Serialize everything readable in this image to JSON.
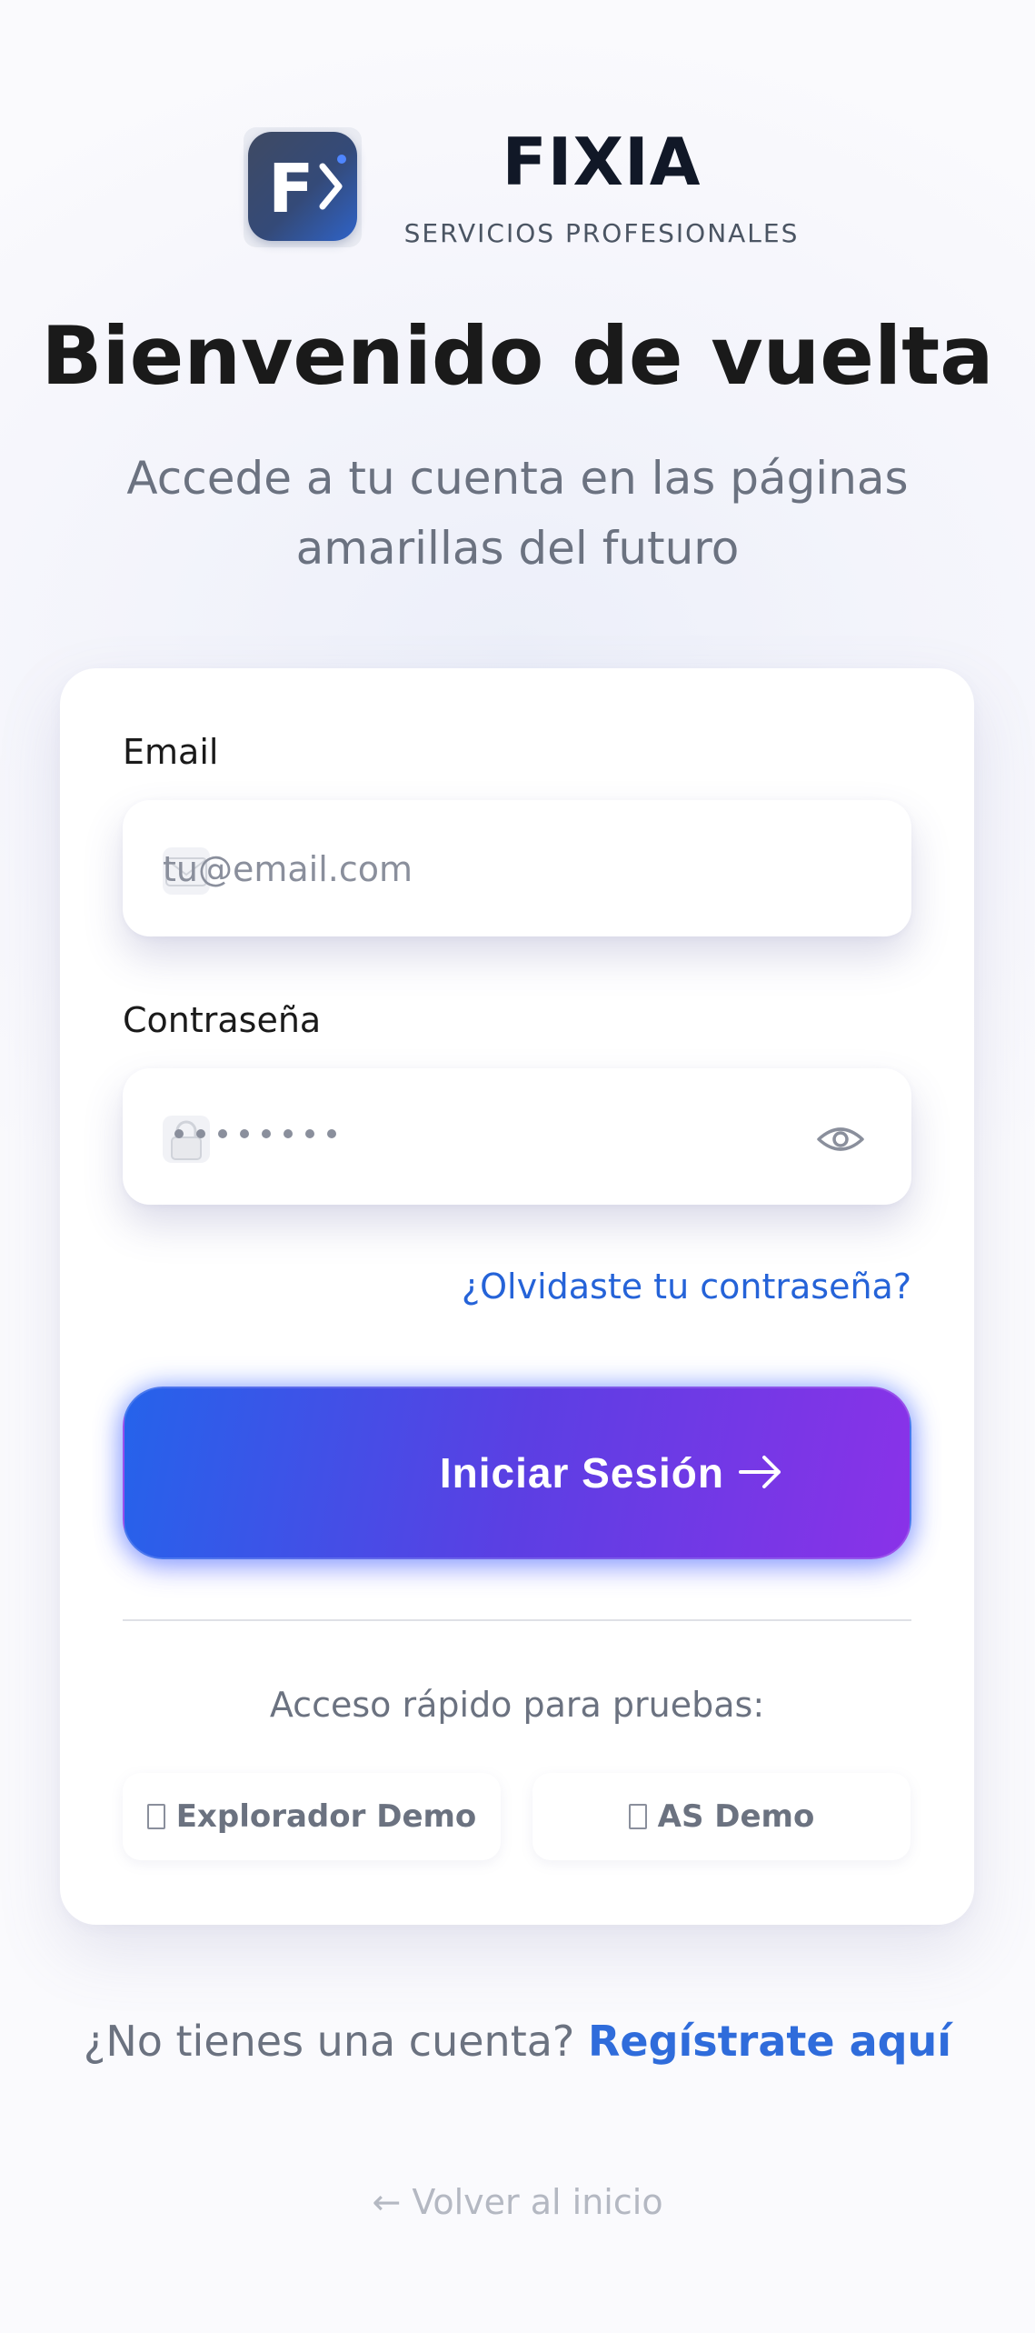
{
  "brand": {
    "name": "FIXIA",
    "tagline": "SERVICIOS PROFESIONALES",
    "logo_letter": "F"
  },
  "welcome": {
    "title": "Bienvenido de vuelta",
    "subtitle": "Accede a tu cuenta en las páginas amarillas del futuro"
  },
  "form": {
    "email": {
      "label": "Email",
      "placeholder": "tu@email.com",
      "value": "",
      "icon": "mail-icon"
    },
    "password": {
      "label": "Contraseña",
      "masked_length": 8,
      "icon": "lock-icon",
      "toggle_icon": "eye-icon"
    },
    "forgot_link": "¿Olvidaste tu contraseña?",
    "submit_label": "Iniciar Sesión",
    "submit_icon": "arrow-right-icon"
  },
  "quick_access": {
    "label": "Acceso rápido para pruebas:",
    "buttons": [
      {
        "label": "Explorador Demo"
      },
      {
        "label": "AS Demo"
      }
    ]
  },
  "footer": {
    "signup_prompt": "¿No tienes una cuenta?",
    "signup_link": "Regístrate aquí",
    "back_link": "← Volver al inicio"
  },
  "colors": {
    "primary_blue": "#2563eb",
    "primary_purple": "#8a32e8",
    "link_blue": "#2563d8",
    "text_dark": "#1a1a1a",
    "text_muted": "#6b7280"
  }
}
